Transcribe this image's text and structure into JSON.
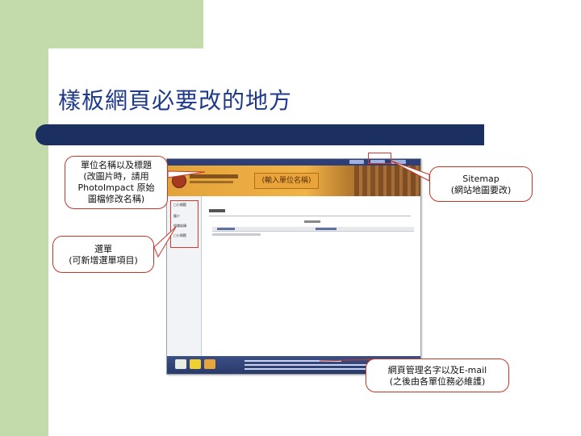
{
  "slide": {
    "title": "樣板網頁必要改的地方"
  },
  "callouts": {
    "unit_title": "單位名稱以及標題\n(改圖片時，請用\nPhotoImpact 原始\n圖檔修改名稱)",
    "menu": "選單\n(可新增選單項目)",
    "sitemap": "Sitemap\n(網站地圖要改)",
    "webmaster": "網頁管理名字以及E-mail\n(之後由各單位務必維護)"
  },
  "screenshot": {
    "unit_placeholder": "(輸入單位名稱)",
    "menu_items": [
      "□小標題",
      "簡介",
      "組織架構",
      "□小標題"
    ]
  },
  "colors": {
    "green_bg": "#c3dbab",
    "title_blue": "#1f3a8a",
    "navy_bar": "#1b2f60",
    "callout_border": "#c0392b",
    "highlight_red": "#d33a2b"
  }
}
